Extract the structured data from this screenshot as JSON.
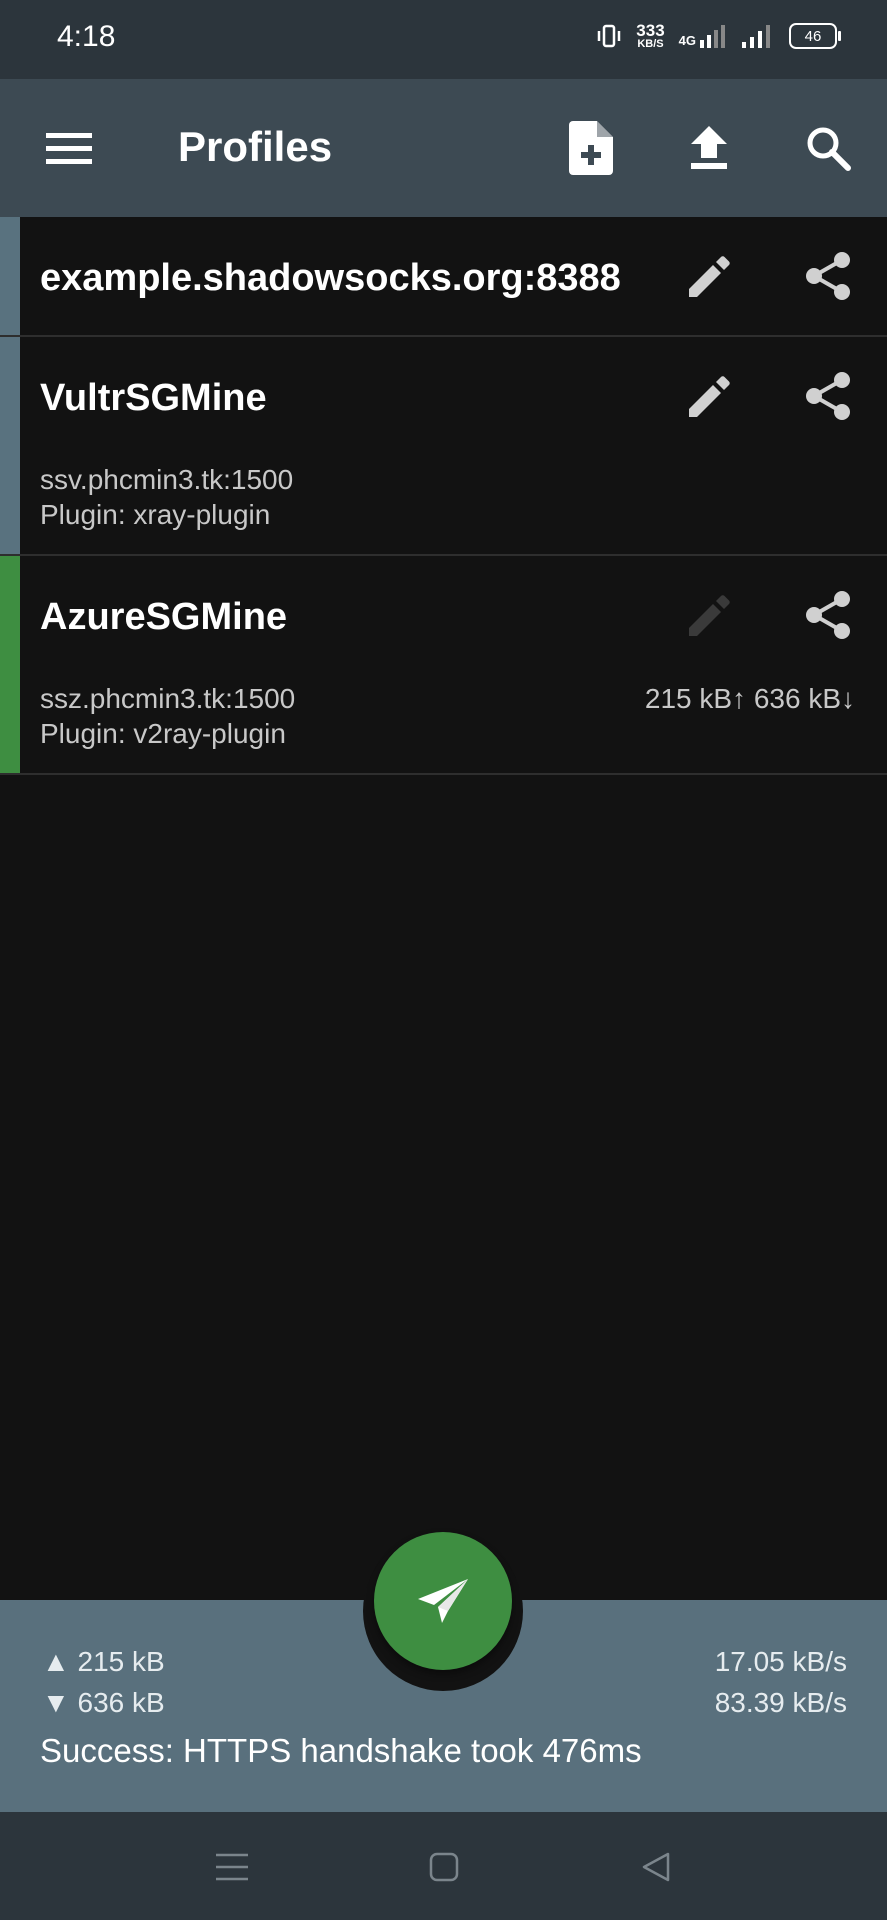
{
  "status_bar": {
    "time": "4:18",
    "net_speed_value": "333",
    "net_speed_unit": "KB/S",
    "network_type": "4G",
    "battery": "46"
  },
  "toolbar": {
    "title": "Profiles",
    "icons": [
      "menu-icon",
      "add-file-icon",
      "upload-icon",
      "search-icon"
    ]
  },
  "profiles": [
    {
      "name": "example.shadowsocks.org:8388",
      "server": "",
      "plugin": "",
      "traffic": "",
      "active": false,
      "edit_enabled": true
    },
    {
      "name": "VultrSGMine",
      "server": "ssv.phcmin3.tk:1500",
      "plugin": "Plugin: xray-plugin",
      "traffic": "",
      "active": false,
      "edit_enabled": true
    },
    {
      "name": "AzureSGMine",
      "server": "ssz.phcmin3.tk:1500",
      "plugin": "Plugin: v2ray-plugin",
      "traffic": "215 kB↑ 636 kB↓",
      "active": true,
      "edit_enabled": false
    }
  ],
  "stats": {
    "upload_total": "▲ 215 kB",
    "download_total": "▼ 636 kB",
    "upload_rate": "17.05 kB/s",
    "download_rate": "83.39 kB/s",
    "status_message": "Success: HTTPS handshake took 476ms"
  },
  "colors": {
    "accent_green": "#3e8e41",
    "toolbar": "#3d4a53",
    "stats_bar": "#59707d",
    "inactive_stripe": "#59727f"
  }
}
